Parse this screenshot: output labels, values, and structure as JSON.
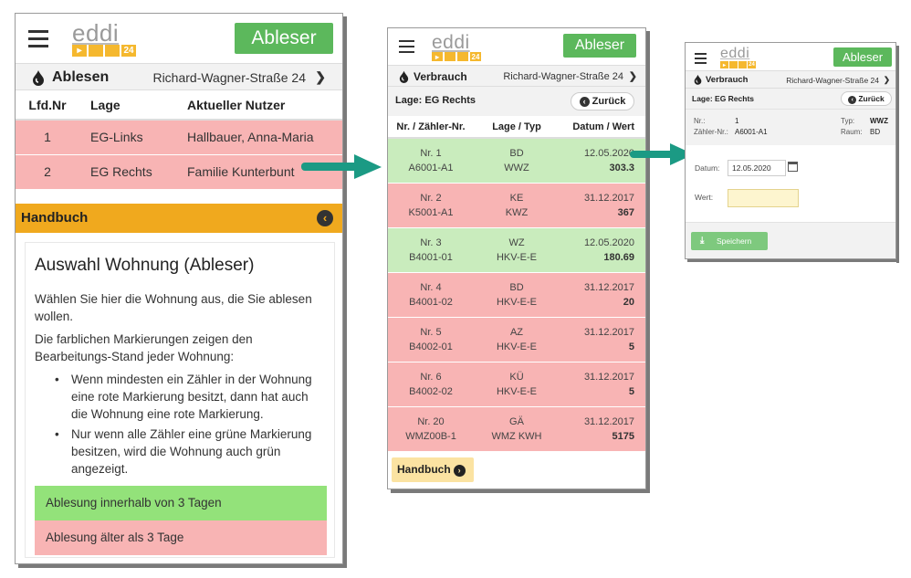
{
  "brand": {
    "logo_text": "eddi",
    "logo_badge": "24",
    "role_button": "Ableser",
    "green": "#5cb85c",
    "orange": "#f0a91e",
    "red_row": "#f8b4b4",
    "green_row": "#c9ecbd"
  },
  "panel1": {
    "section": "Ablesen",
    "street": "Richard-Wagner-Straße 24",
    "columns": [
      "Lfd.Nr",
      "Lage",
      "Aktueller Nutzer"
    ],
    "rows": [
      {
        "nr": "1",
        "lage": "EG-Links",
        "nutzer": "Hallbauer, Anna-Maria"
      },
      {
        "nr": "2",
        "lage": "EG Rechts",
        "nutzer": "Familie Kunterbunt"
      }
    ],
    "handbuch": {
      "bar_label": "Handbuch",
      "title": "Auswahl Wohnung (Ableser)",
      "p1": "Wählen Sie hier die Wohnung aus, die Sie ablesen wollen.",
      "p2": "Die farblichen Markierungen zeigen den Bearbeitungs-Stand jeder Wohnung:",
      "bullets": [
        "Wenn mindesten ein Zähler in der Wohnung eine rote Markierung besitzt, dann hat auch die Wohnung eine rote Markierung.",
        "Nur wenn alle Zähler eine grüne Markierung besitzen, wird die Wohnung auch grün angezeigt."
      ],
      "legend_green": "Ablesung innerhalb von 3 Tagen",
      "legend_red": "Ablesung älter als 3 Tage"
    }
  },
  "panel2": {
    "section": "Verbrauch",
    "street": "Richard-Wagner-Straße 24",
    "lage": "Lage: EG Rechts",
    "back": "Zurück",
    "columns": [
      "Nr. / Zähler-Nr.",
      "Lage / Typ",
      "Datum / Wert"
    ],
    "rows": [
      {
        "nr": "Nr. 1",
        "zaehler": "A6001-A1",
        "lage": "BD",
        "typ": "WWZ",
        "datum": "12.05.2020",
        "wert": "303.3",
        "status": "green"
      },
      {
        "nr": "Nr. 2",
        "zaehler": "K5001-A1",
        "lage": "KE",
        "typ": "KWZ",
        "datum": "31.12.2017",
        "wert": "367",
        "status": "red"
      },
      {
        "nr": "Nr. 3",
        "zaehler": "B4001-01",
        "lage": "WZ",
        "typ": "HKV-E-E",
        "datum": "12.05.2020",
        "wert": "180.69",
        "status": "green"
      },
      {
        "nr": "Nr. 4",
        "zaehler": "B4001-02",
        "lage": "BD",
        "typ": "HKV-E-E",
        "datum": "31.12.2017",
        "wert": "20",
        "status": "red"
      },
      {
        "nr": "Nr. 5",
        "zaehler": "B4002-01",
        "lage": "AZ",
        "typ": "HKV-E-E",
        "datum": "31.12.2017",
        "wert": "5",
        "status": "red"
      },
      {
        "nr": "Nr. 6",
        "zaehler": "B4002-02",
        "lage": "KÜ",
        "typ": "HKV-E-E",
        "datum": "31.12.2017",
        "wert": "5",
        "status": "red"
      },
      {
        "nr": "Nr. 20",
        "zaehler": "WMZ00B-1",
        "lage": "GÄ",
        "typ": "WMZ KWH",
        "datum": "31.12.2017",
        "wert": "5175",
        "status": "red"
      }
    ],
    "handbuch_button": "Handbuch"
  },
  "panel3": {
    "section": "Verbrauch",
    "street": "Richard-Wagner-Straße 24",
    "lage": "Lage: EG Rechts",
    "back": "Zurück",
    "nr_label": "Nr.:",
    "nr_value": "1",
    "zaehler_label": "Zähler-Nr.:",
    "zaehler_value": "A6001-A1",
    "typ_label": "Typ:",
    "typ_value": "WWZ",
    "raum_label": "Raum:",
    "raum_value": "BD",
    "datum_label": "Datum:",
    "datum_value": "12.05.2020",
    "wert_label": "Wert:",
    "wert_value": "",
    "save": "Speichern"
  }
}
